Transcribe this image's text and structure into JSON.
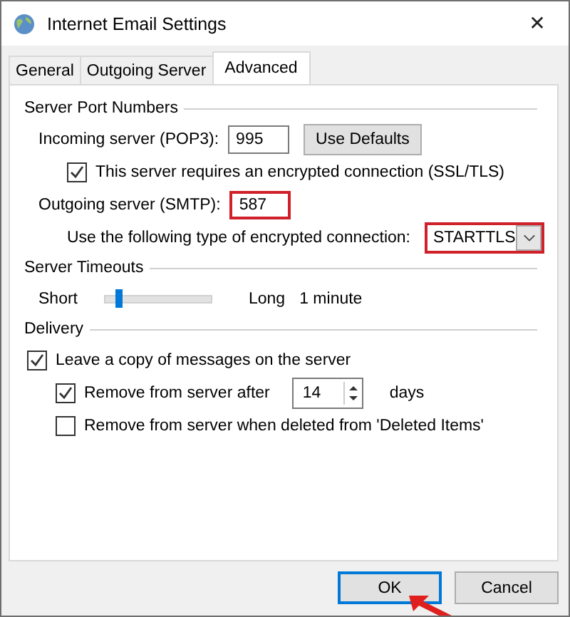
{
  "window": {
    "title": "Internet Email Settings",
    "close": "✕"
  },
  "tabs": [
    {
      "label": "General",
      "selected": false
    },
    {
      "label": "Outgoing Server",
      "selected": false
    },
    {
      "label": "Advanced",
      "selected": true
    }
  ],
  "port_numbers": {
    "heading": "Server Port Numbers",
    "incoming": {
      "label": "Incoming server (POP3):",
      "value": "995",
      "highlighted": false
    },
    "use_defaults": "Use Defaults",
    "ssl": {
      "label": "This server requires an encrypted connection (SSL/TLS)",
      "checked": true
    },
    "outgoing": {
      "label": "Outgoing server (SMTP):",
      "value": "587",
      "highlighted": true
    },
    "encryption": {
      "label": "Use the following type of encrypted connection:",
      "value": "STARTTLS",
      "highlighted": true
    }
  },
  "timeouts": {
    "heading": "Server Timeouts",
    "short": "Short",
    "long": "Long",
    "level": 0.1,
    "reading": "1 minute"
  },
  "delivery": {
    "heading": "Delivery",
    "leave_copy": {
      "label": "Leave a copy of messages on the server",
      "checked": true
    },
    "remove_after": {
      "label": "Remove from server after",
      "checked": true,
      "value": "14",
      "unit": "days"
    },
    "remove_deleted": {
      "label": "Remove from server when deleted from 'Deleted Items'",
      "checked": false
    }
  },
  "buttons": [
    {
      "label": "OK",
      "default": true,
      "pointed": true
    },
    {
      "label": "Cancel",
      "default": false,
      "pointed": false
    }
  ]
}
